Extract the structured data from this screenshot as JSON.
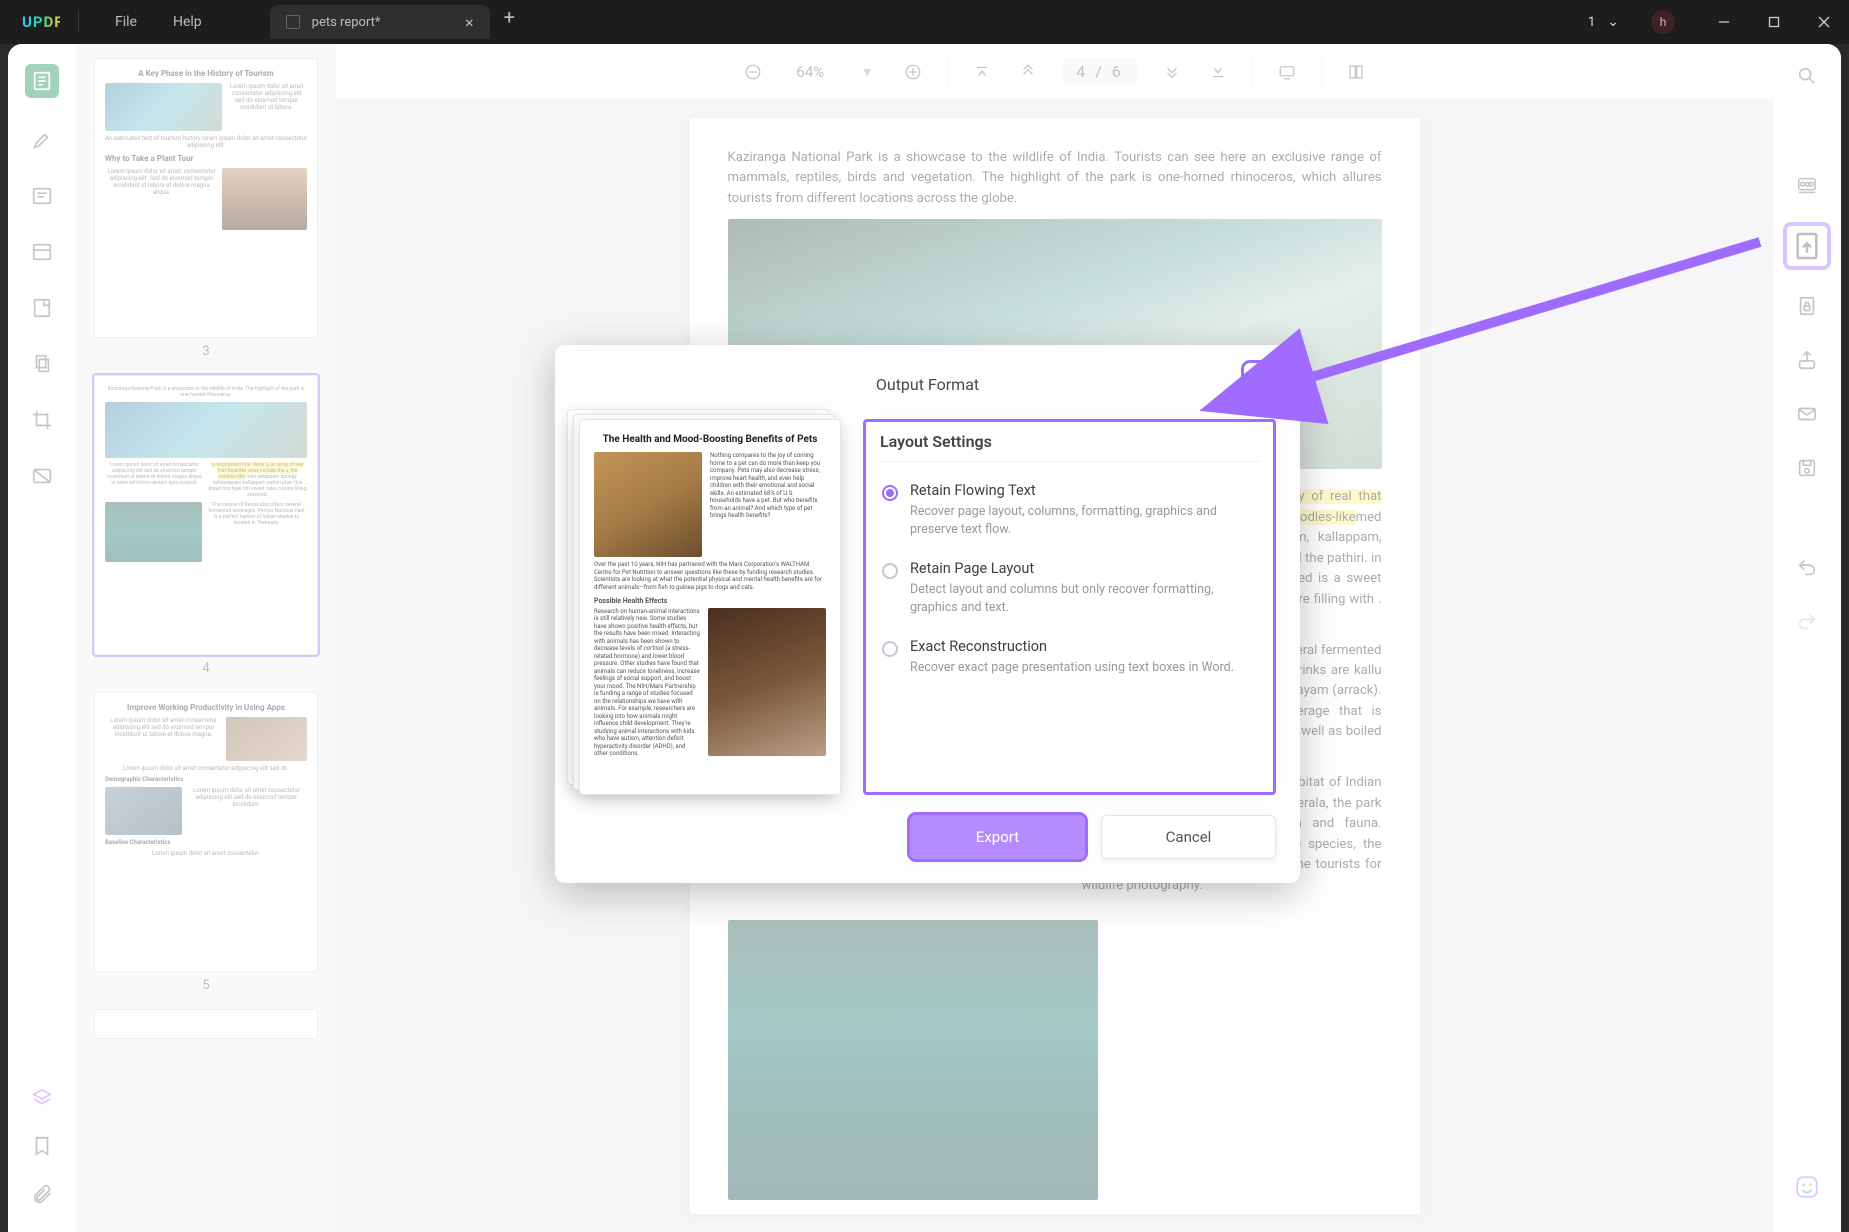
{
  "title_bar": {
    "logo": "UPDF",
    "menu": {
      "file": "File",
      "help": "Help"
    },
    "tab": {
      "name": "pets report*",
      "dirty": true
    },
    "windows_count": "1",
    "avatar_letter": "h"
  },
  "toolbar": {
    "zoom": "64%",
    "page_display": "4 / 6",
    "current_page": 4,
    "total_pages": 6
  },
  "thumbnails": [
    {
      "num": "3",
      "title": "A Key Phase in the History of Tourism",
      "sub": "Why to Take a Plant Tour"
    },
    {
      "num": "4",
      "title": ""
    },
    {
      "num": "5",
      "title": "Improve Working Productivity in Using Apps",
      "sub1": "Demographic Characteristics",
      "sub2": "Baseline Characteristics"
    }
  ],
  "document": {
    "p1": "Kaziranga National Park is a showcase to the wildlife of India. Tourists can see here an exclusive range of mammals, reptiles, birds and vegetation. The highlight of the park is one-horned rhinoceros, which allures tourists from different locations across the globe.",
    "hl": "is unpolished rice. there is an array of real that Keralites ones include the u, the noodles-like",
    "p2a": "med palappam, the spongy vattayappam, kallappam, and the a. This is not all. The is called the pathiri. in plain thin bread a box type roti called is a sweet cake that rt of the cuisine of ed before filling with . They are steamed",
    "p3": "The cuisine of Kerala also offers several fermented beverages of its own. The famous drinks are kallu (toddy), Kerala rasam and patta charayam (arrack). Arrack is a very intoxicating beverage that is generally eaten along with pickles as well as boiled eggs.",
    "p4": "Periyar National Park is a perfect habitat of Indian elephants. Located in Thekkady in Kerala, the park boasts of a rich variety of flora and fauna. Providing shelter to various wildlife species, the park offers ample opportunities to the tourists for wildlife photography."
  },
  "modal": {
    "title": "Output Format",
    "preview_title": "The Health and Mood-Boosting Benefits of Pets",
    "preview_sub": "Possible Health Effects",
    "settings_title": "Layout Settings",
    "options": [
      {
        "title": "Retain Flowing Text",
        "desc": "Recover page layout, columns, formatting, graphics and preserve text flow.",
        "selected": true
      },
      {
        "title": "Retain Page Layout",
        "desc": "Detect layout and columns but only recover formatting, graphics and text.",
        "selected": false
      },
      {
        "title": "Exact Reconstruction",
        "desc": "Recover exact page presentation using text boxes in Word.",
        "selected": false
      }
    ],
    "export": "Export",
    "cancel": "Cancel"
  },
  "icons": {
    "search": "search-icon",
    "ocr": "ocr-icon",
    "export": "export-tool-icon",
    "lock": "lock-doc-icon",
    "share": "share-icon",
    "mail": "mail-icon",
    "save": "save-icon",
    "undo": "undo-icon",
    "redo": "redo-icon",
    "ai": "ai-icon"
  }
}
